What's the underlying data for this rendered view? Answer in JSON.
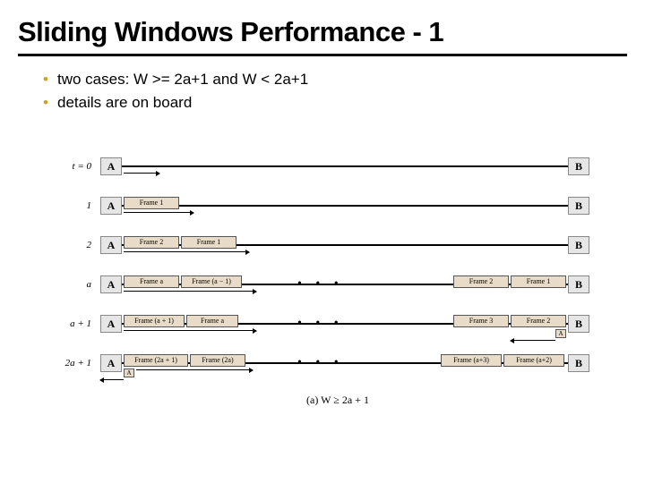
{
  "title": "Sliding Windows Performance - 1",
  "bullets": [
    "two cases: W >= 2a+1 and W < 2a+1",
    "details are on board"
  ],
  "diagram": {
    "nodeA": "A",
    "nodeB": "B",
    "ackLabel": "A",
    "rows": [
      {
        "time": "t = 0",
        "leftFrames": [],
        "rightFrames": [],
        "dots": false,
        "ack": false
      },
      {
        "time": "1",
        "leftFrames": [
          "Frame 1"
        ],
        "rightFrames": [],
        "dots": false,
        "ack": false
      },
      {
        "time": "2",
        "leftFrames": [
          "Frame 2",
          "Frame 1"
        ],
        "rightFrames": [],
        "dots": false,
        "ack": false
      },
      {
        "time": "a",
        "leftFrames": [
          "Frame a",
          "Frame (a − 1)"
        ],
        "rightFrames": [
          "Frame 2",
          "Frame 1"
        ],
        "dots": true,
        "ack": false
      },
      {
        "time": "a + 1",
        "leftFrames": [
          "Frame (a + 1)",
          "Frame a"
        ],
        "rightFrames": [
          "Frame 3",
          "Frame 2"
        ],
        "dots": true,
        "ack": true
      },
      {
        "time": "2a + 1",
        "leftFrames": [
          "Frame (2a + 1)",
          "Frame (2a)"
        ],
        "rightFrames": [
          "Frame (a+3)",
          "Frame (a+2)"
        ],
        "dots": true,
        "ack": true
      }
    ],
    "caption": "(a) W ≥ 2a + 1"
  }
}
